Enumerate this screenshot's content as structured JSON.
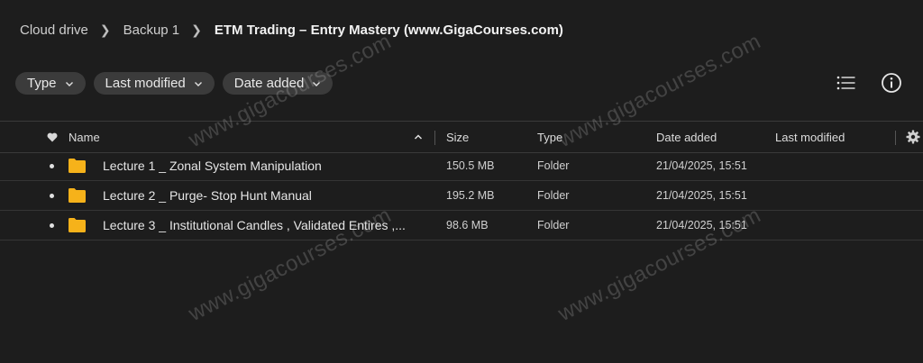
{
  "breadcrumb": {
    "items": [
      "Cloud drive",
      "Backup 1"
    ],
    "current": "ETM Trading – Entry Mastery (www.GigaCourses.com)"
  },
  "filters": [
    {
      "label": "Type"
    },
    {
      "label": "Last modified"
    },
    {
      "label": "Date added"
    }
  ],
  "toolbar": {
    "list_icon": "list-view-icon",
    "info_icon": "info-icon"
  },
  "table": {
    "headers": {
      "name": "Name",
      "size": "Size",
      "type": "Type",
      "date_added": "Date added",
      "last_modified": "Last modified"
    },
    "rows": [
      {
        "name": "Lecture 1 _ Zonal System Manipulation",
        "size": "150.5 MB",
        "type": "Folder",
        "date_added": "21/04/2025, 15:51",
        "last_modified": ""
      },
      {
        "name": "Lecture 2 _ Purge- Stop Hunt Manual",
        "size": "195.2 MB",
        "type": "Folder",
        "date_added": "21/04/2025, 15:51",
        "last_modified": ""
      },
      {
        "name": "Lecture 3 _ Institutional Candles , Validated Entires ,...",
        "size": "98.6 MB",
        "type": "Folder",
        "date_added": "21/04/2025, 15:51",
        "last_modified": ""
      }
    ]
  },
  "watermark": {
    "text": "www.gigacourses.com"
  },
  "colors": {
    "background": "#1d1d1d",
    "folder": "#f6b21a",
    "chip": "#3b3b3b"
  }
}
